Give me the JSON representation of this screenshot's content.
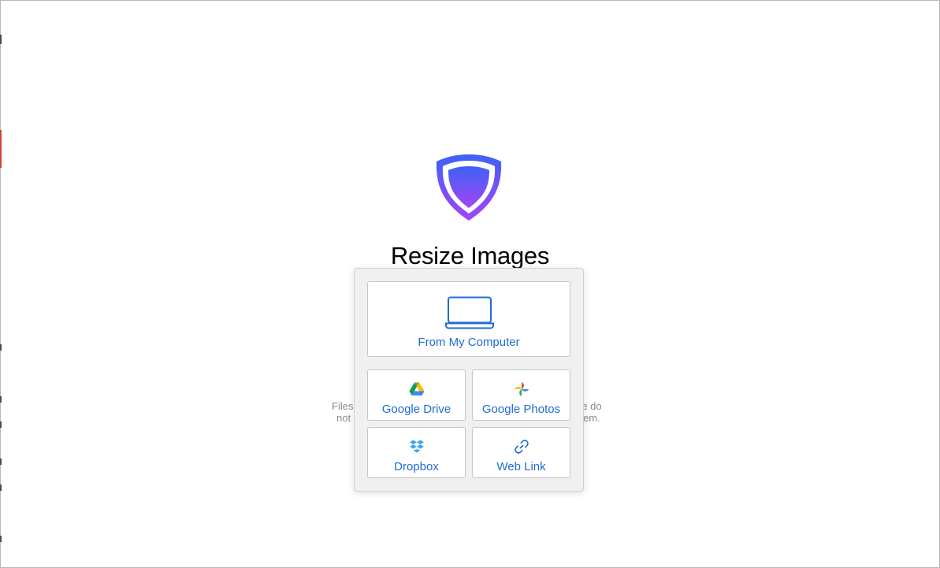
{
  "page": {
    "title": "Resize Images",
    "privacy_left_line1": "Files",
    "privacy_left_line2": "not",
    "privacy_right_line1": "re do",
    "privacy_right_line2": "em."
  },
  "upload_sources": {
    "computer_label": "From My Computer",
    "google_drive_label": "Google Drive",
    "google_photos_label": "Google Photos",
    "dropbox_label": "Dropbox",
    "web_link_label": "Web Link"
  },
  "colors": {
    "link_blue": "#1f6bd6",
    "logo_gradient_top": "#3d63f6",
    "logo_gradient_bottom": "#a543f5"
  }
}
